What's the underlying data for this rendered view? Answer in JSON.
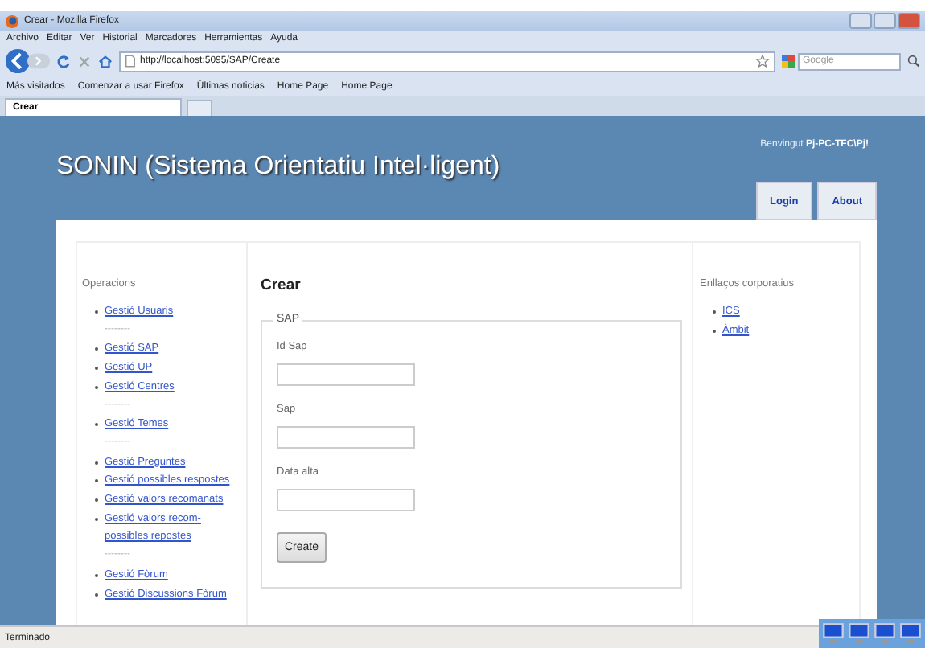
{
  "window": {
    "title": "Crear - Mozilla Firefox"
  },
  "menu": [
    "Archivo",
    "Editar",
    "Ver",
    "Historial",
    "Marcadores",
    "Herramientas",
    "Ayuda"
  ],
  "address": {
    "value": "http://localhost:5095/SAP/Create"
  },
  "search": {
    "placeholder": "Google"
  },
  "bookmarks": [
    "Más visitados",
    "Comenzar a usar Firefox",
    "Últimas noticias",
    "Home Page",
    "Home Page"
  ],
  "tabs": [
    {
      "label": "Crear",
      "selected": true
    }
  ],
  "site": {
    "title": "SONIN (Sistema Orientatiu Intel·ligent)",
    "welcome": "Benvingut",
    "user": "Pj-PC-TFC\\Pj!",
    "nav": [
      "Login",
      "About"
    ]
  },
  "left": {
    "heading": "Operacions",
    "items": [
      {
        "kind": "link",
        "text": "Gestió Usuaris"
      },
      {
        "kind": "separator",
        "text": "--------"
      },
      {
        "kind": "link",
        "text": "Gestió SAP"
      },
      {
        "kind": "link",
        "text": "Gestió UP"
      },
      {
        "kind": "link",
        "text": "Gestió Centres"
      },
      {
        "kind": "separator",
        "text": "--------"
      },
      {
        "kind": "link",
        "text": "Gestió Temes"
      },
      {
        "kind": "separator",
        "text": "--------"
      },
      {
        "kind": "link",
        "text": "Gestió Preguntes"
      },
      {
        "kind": "link",
        "text": "Gestió possibles respostes"
      },
      {
        "kind": "link",
        "text": "Gestió valors recomanats"
      },
      {
        "kind": "link",
        "text": "Gestió valors recom-possibles repostes"
      },
      {
        "kind": "separator",
        "text": "--------"
      },
      {
        "kind": "link",
        "text": "Gestió Fòrum"
      },
      {
        "kind": "link",
        "text": "Gestió Discussions Fòrum"
      }
    ]
  },
  "main": {
    "heading": "Crear",
    "legend": "SAP",
    "fields": [
      {
        "label": "Id Sap"
      },
      {
        "label": "Sap"
      },
      {
        "label": "Data alta"
      }
    ],
    "button": "Create"
  },
  "right": {
    "heading": "Enllaços corporatius",
    "links": [
      "ICS",
      "Àmbit"
    ]
  },
  "status_bar": "Terminado"
}
